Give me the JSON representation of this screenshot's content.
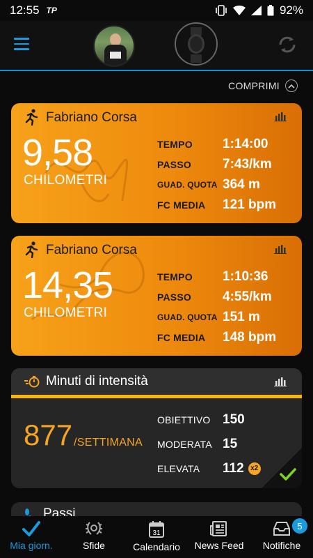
{
  "statusbar": {
    "time": "12:55",
    "carrier": "TP",
    "battery": "92%"
  },
  "header": {
    "collapse_label": "COMPRIMI"
  },
  "activities": [
    {
      "title": "Fabriano Corsa",
      "distance": "9,58",
      "unit": "CHILOMETRI",
      "stats": [
        {
          "label": "TEMPO",
          "value": "1:14:00"
        },
        {
          "label": "PASSO",
          "value": "7:43/km"
        },
        {
          "label": "GUAD. QUOTA",
          "value": "364 m"
        },
        {
          "label": "FC MEDIA",
          "value": "121 bpm"
        }
      ]
    },
    {
      "title": "Fabriano Corsa",
      "distance": "14,35",
      "unit": "CHILOMETRI",
      "stats": [
        {
          "label": "TEMPO",
          "value": "1:10:36"
        },
        {
          "label": "PASSO",
          "value": "4:55/km"
        },
        {
          "label": "GUAD. QUOTA",
          "value": "151 m"
        },
        {
          "label": "FC MEDIA",
          "value": "148 bpm"
        }
      ]
    }
  ],
  "intensity": {
    "title": "Minuti di intensità",
    "value": "877",
    "period": "/SETTIMANA",
    "stats": [
      {
        "label": "OBIETTIVO",
        "value": "150"
      },
      {
        "label": "MODERATA",
        "value": "15"
      },
      {
        "label": "ELEVATA",
        "value": "112"
      }
    ],
    "multiplier": "x2"
  },
  "steps": {
    "title": "Passi"
  },
  "nav": {
    "items": [
      {
        "label": "Mia giorn."
      },
      {
        "label": "Sfide"
      },
      {
        "label": "Calendario",
        "icon_text": "31"
      },
      {
        "label": "News Feed"
      },
      {
        "label": "Notifiche",
        "badge": "5"
      }
    ]
  },
  "colors": {
    "accent": "#1a9be0",
    "card_orange": "#f09010",
    "intensity_yellow": "#f5b60f",
    "success_green": "#7ed321"
  }
}
